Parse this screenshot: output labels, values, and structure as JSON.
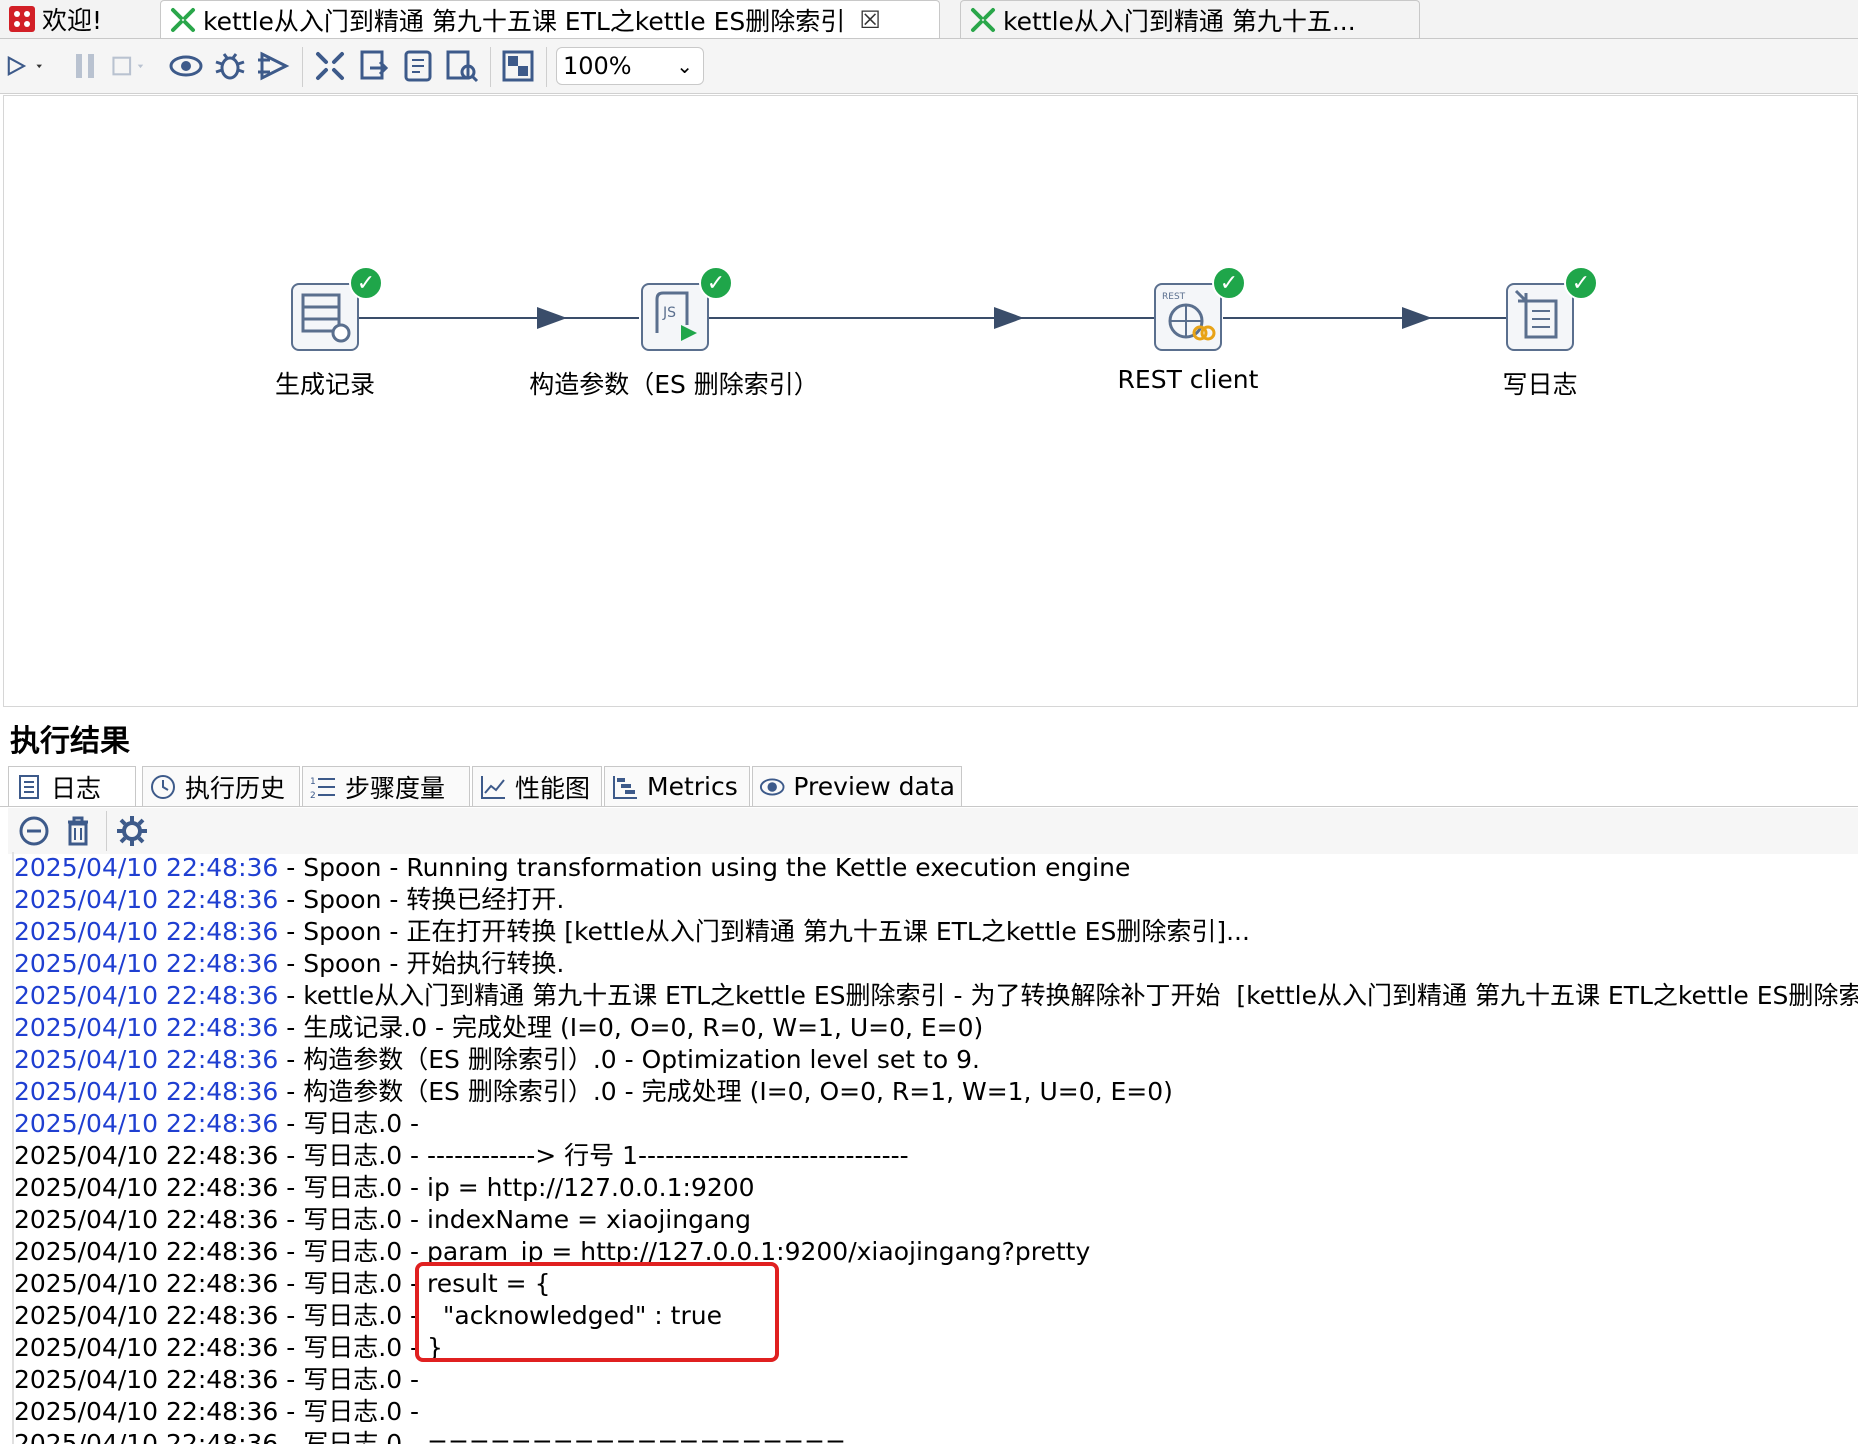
{
  "tabs": [
    {
      "label": "欢迎!",
      "active": false
    },
    {
      "label": "kettle从入门到精通 第九十五课 ETL之kettle ES删除索引",
      "active": true,
      "close": "☒"
    },
    {
      "label": "kettle从入门到精通 第九十五...",
      "active": false
    }
  ],
  "toolbar": {
    "icons": [
      "run-icon",
      "pause-icon",
      "stop-icon",
      "preview-icon",
      "debug-icon",
      "replay-icon",
      "verify-icon",
      "impact-icon",
      "sql-icon",
      "explore-db-icon",
      "show-results-icon"
    ],
    "zoom": "100%"
  },
  "steps": [
    {
      "label": "生成记录"
    },
    {
      "label": "构造参数（ES 删除索引）"
    },
    {
      "label": "REST client"
    },
    {
      "label": "写日志"
    }
  ],
  "results": {
    "title": "执行结果",
    "tabs": [
      "日志",
      "执行历史",
      "步骤度量",
      "性能图",
      "Metrics",
      "Preview data"
    ]
  },
  "log": [
    {
      "ts": "2025/04/10 22:48:36",
      "msg": " - Spoon - Running transformation using the Kettle execution engine",
      "blue": true
    },
    {
      "ts": "2025/04/10 22:48:36",
      "msg": " - Spoon - 转换已经打开.",
      "blue": true
    },
    {
      "ts": "2025/04/10 22:48:36",
      "msg": " - Spoon - 正在打开转换 [kettle从入门到精通 第九十五课 ETL之kettle ES删除索引]...",
      "blue": true
    },
    {
      "ts": "2025/04/10 22:48:36",
      "msg": " - Spoon - 开始执行转换.",
      "blue": true
    },
    {
      "ts": "2025/04/10 22:48:36",
      "msg": " - kettle从入门到精通 第九十五课 ETL之kettle ES删除索引 - 为了转换解除补丁开始  [kettle从入门到精通 第九十五课 ETL之kettle ES删除索引]",
      "blue": true
    },
    {
      "ts": "2025/04/10 22:48:36",
      "msg": " - 生成记录.0 - 完成处理 (I=0, O=0, R=0, W=1, U=0, E=0)",
      "blue": true
    },
    {
      "ts": "2025/04/10 22:48:36",
      "msg": " - 构造参数（ES 删除索引）.0 - Optimization level set to 9.",
      "blue": true
    },
    {
      "ts": "2025/04/10 22:48:36",
      "msg": " - 构造参数（ES 删除索引）.0 - 完成处理 (I=0, O=0, R=1, W=1, U=0, E=0)",
      "blue": true
    },
    {
      "ts": "2025/04/10 22:48:36",
      "msg": " - 写日志.0 - ",
      "blue": true
    },
    {
      "ts": "2025/04/10 22:48:36",
      "msg": " - 写日志.0 - ------------> 行号 1------------------------------",
      "blue": false
    },
    {
      "ts": "2025/04/10 22:48:36",
      "msg": " - 写日志.0 - ip = http://127.0.0.1:9200",
      "blue": false
    },
    {
      "ts": "2025/04/10 22:48:36",
      "msg": " - 写日志.0 - indexName = xiaojingang",
      "blue": false
    },
    {
      "ts": "2025/04/10 22:48:36",
      "msg": " - 写日志.0 - param_ip = http://127.0.0.1:9200/xiaojingang?pretty",
      "blue": false
    },
    {
      "ts": "2025/04/10 22:48:36",
      "msg": " - 写日志.0 - result = {",
      "blue": false
    },
    {
      "ts": "2025/04/10 22:48:36",
      "msg": " - 写日志.0 -   \"acknowledged\" : true",
      "blue": false
    },
    {
      "ts": "2025/04/10 22:48:36",
      "msg": " - 写日志.0 - }",
      "blue": false
    },
    {
      "ts": "2025/04/10 22:48:36",
      "msg": " - 写日志.0 - ",
      "blue": false
    },
    {
      "ts": "2025/04/10 22:48:36",
      "msg": " - 写日志.0 - ",
      "blue": false
    },
    {
      "ts": "2025/04/10 22:48:36",
      "msg": " - 写日志.0 - ====================",
      "blue": false
    }
  ],
  "colors": {
    "accent_blue": "#1f3fd1",
    "success_green": "#1fa64a",
    "highlight_red": "#e02020",
    "hop": "#3a4d6a"
  }
}
